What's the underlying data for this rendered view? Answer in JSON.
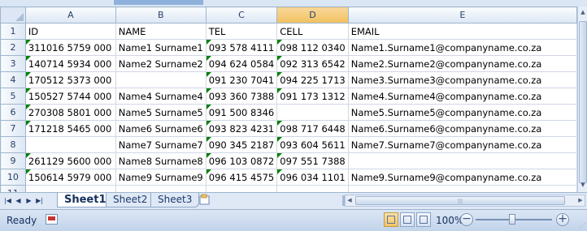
{
  "spreadsheet": {
    "row_header_label": "",
    "columns": [
      "A",
      "B",
      "C",
      "D",
      "E"
    ],
    "selected_column": "D",
    "rows": [
      {
        "num": "1",
        "cells": [
          "ID",
          "NAME",
          "TEL",
          "CELL",
          "EMAIL"
        ],
        "flags": [
          false,
          false,
          false,
          false,
          false
        ]
      },
      {
        "num": "2",
        "cells": [
          "311016 5759 000",
          "Name1 Surname1",
          "093 578 4111",
          "098 112 0340",
          "Name1.Surname1@companyname.co.za"
        ],
        "flags": [
          true,
          false,
          true,
          true,
          false
        ]
      },
      {
        "num": "3",
        "cells": [
          "140714 5934 000",
          "Name2 Surname2",
          "094 624 0584",
          "092 313 6542",
          "Name2.Surname2@companyname.co.za"
        ],
        "flags": [
          true,
          false,
          true,
          true,
          false
        ]
      },
      {
        "num": "4",
        "cells": [
          "170512 5373 000",
          "",
          "091 230 7041",
          "094 225 1713",
          "Name3.Surname3@companyname.co.za"
        ],
        "flags": [
          true,
          false,
          true,
          true,
          false
        ]
      },
      {
        "num": "5",
        "cells": [
          "150527 5744 000",
          "Name4 Surname4",
          "093 360 7388",
          "091 173 1312",
          "Name4.Surname4@companyname.co.za"
        ],
        "flags": [
          true,
          false,
          true,
          true,
          false
        ]
      },
      {
        "num": "6",
        "cells": [
          "270308 5801 000",
          "Name5 Surname5",
          "091 500 8346",
          "",
          "Name5.Surname5@companyname.co.za"
        ],
        "flags": [
          true,
          false,
          true,
          false,
          false
        ]
      },
      {
        "num": "7",
        "cells": [
          "171218 5465 000",
          "Name6 Surname6",
          "093 823 4231",
          "098 717 6448",
          "Name6.Surname6@companyname.co.za"
        ],
        "flags": [
          true,
          false,
          true,
          true,
          false
        ]
      },
      {
        "num": "8",
        "cells": [
          "",
          "Name7 Surname7",
          "090 345 2187",
          "093 604 5611",
          "Name7.Surname7@companyname.co.za"
        ],
        "flags": [
          false,
          false,
          true,
          true,
          false
        ]
      },
      {
        "num": "9",
        "cells": [
          "261129 5600 000",
          "Name8 Surname8",
          "096 103 0872",
          "097 551 7388",
          ""
        ],
        "flags": [
          true,
          false,
          true,
          true,
          false
        ]
      },
      {
        "num": "10",
        "cells": [
          "150614 5979 000",
          "Name9 Surname9",
          "096 415 4575",
          "096 034 1101",
          "Name9.Surname9@companyname.co.za"
        ],
        "flags": [
          true,
          false,
          true,
          true,
          false
        ]
      },
      {
        "num": "11",
        "cells": [
          "",
          "",
          "",
          "",
          ""
        ],
        "flags": [
          false,
          false,
          false,
          false,
          false
        ]
      }
    ]
  },
  "sheet_tabs": {
    "tabs": [
      "Sheet1",
      "Sheet2",
      "Sheet3"
    ],
    "active": "Sheet1"
  },
  "status_bar": {
    "ready": "Ready",
    "zoom": "100%",
    "zoom_out": "−",
    "zoom_in": "+"
  },
  "colors": {
    "error_flag": "#008000",
    "selected_column_header": "#f1c15f",
    "gridline": "#d0d7e5"
  }
}
